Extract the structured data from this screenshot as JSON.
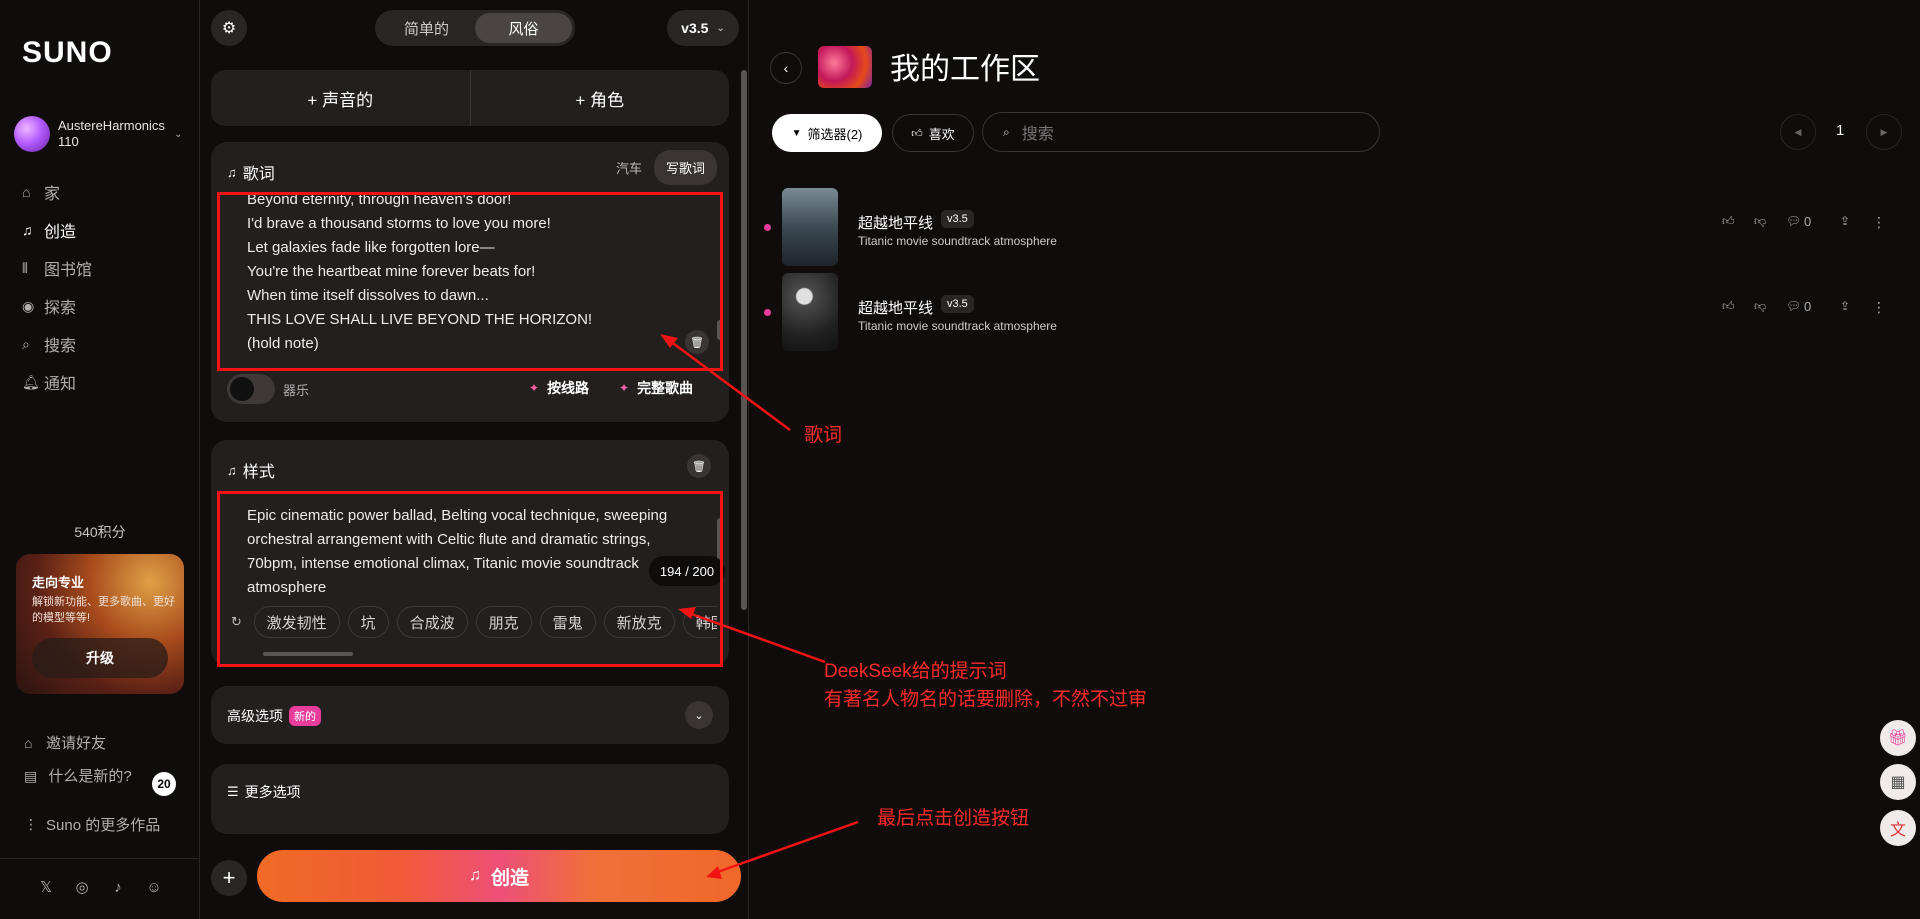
{
  "sidebar": {
    "logo": "SUNO",
    "username": "AustereHarmonics110",
    "nav": [
      {
        "label": "家",
        "icon": "home-icon"
      },
      {
        "label": "创造",
        "icon": "music-note-icon"
      },
      {
        "label": "图书馆",
        "icon": "library-icon"
      },
      {
        "label": "探索",
        "icon": "compass-icon"
      },
      {
        "label": "搜索",
        "icon": "search-icon"
      },
      {
        "label": "通知",
        "icon": "bell-icon"
      }
    ],
    "credits": "540积分",
    "pro": {
      "title": "走向专业",
      "desc": "解锁新功能、更多歌曲、更好的模型等等!",
      "button": "升级"
    },
    "invite": "邀请好友",
    "whats_new": "什么是新的?",
    "whats_new_count": "20",
    "more_works": "Suno 的更多作品"
  },
  "editor": {
    "mode_tabs": [
      "简单的",
      "风俗"
    ],
    "version": "v3.5",
    "add_audio": "+ 声音的",
    "add_persona": "+ 角色",
    "lyrics": {
      "title": "歌词",
      "tab_auto": "汽车",
      "tab_write": "写歌词",
      "lines": [
        "Beyond eternity, through heaven's door!",
        "I'd brave a thousand storms to love you more!",
        "Let galaxies fade like forgotten lore—",
        "You're the heartbeat mine forever beats for!",
        "When time itself dissolves to dawn...",
        "THIS LOVE SHALL LIVE BEYOND THE HORIZON!",
        "(hold note)"
      ],
      "instrumental": "器乐",
      "by_line": "按线路",
      "full_song": "完整歌曲"
    },
    "style": {
      "title": "样式",
      "text": "Epic cinematic power ballad, Belting vocal technique, sweeping orchestral arrangement with Celtic flute and dramatic strings, 70bpm, intense emotional climax, Titanic movie soundtrack atmosphere",
      "counter": "194 / 200",
      "tags": [
        "激发韧性",
        "坑",
        "合成波",
        "朋克",
        "雷鬼",
        "新放克",
        "韩国"
      ]
    },
    "advanced": {
      "label": "高级选项",
      "badge": "新的"
    },
    "more_options": "更多选项",
    "create": "创造"
  },
  "workspace": {
    "title": "我的工作区",
    "filter": "筛选器(2)",
    "like": "喜欢",
    "search_placeholder": "搜索",
    "page": "1",
    "songs": [
      {
        "title": "超越地平线",
        "version": "v3.5",
        "desc": "Titanic movie soundtrack atmosphere",
        "comments": "0"
      },
      {
        "title": "超越地平线",
        "version": "v3.5",
        "desc": "Titanic movie soundtrack atmosphere",
        "comments": "0"
      }
    ]
  },
  "annotations": {
    "lyrics_label": "歌词",
    "style_label_1": "DeekSeek给的提示词",
    "style_label_2": "有著名人物名的话要删除，不然不过审",
    "create_label": "最后点击创造按钮",
    "color": "#ff2a2a"
  },
  "colors": {
    "accent_pink": "#e83d9a",
    "create_orange": "#f06b24",
    "background": "#100c0c"
  }
}
